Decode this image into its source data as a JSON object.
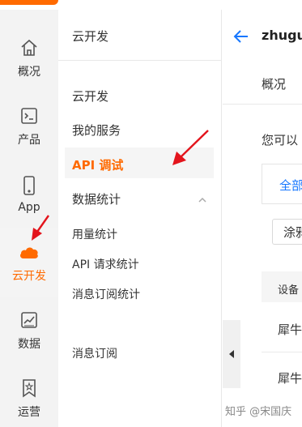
{
  "rail": {
    "items": [
      {
        "label": "概况",
        "icon": "home-icon"
      },
      {
        "label": "产品",
        "icon": "terminal-icon"
      },
      {
        "label": "App",
        "icon": "phone-icon"
      },
      {
        "label": "云开发",
        "icon": "cloud-icon"
      },
      {
        "label": "数据",
        "icon": "chart-icon"
      },
      {
        "label": "运营",
        "icon": "bookmark-star-icon"
      }
    ],
    "active_index": 3
  },
  "menu": {
    "title": "云开发",
    "items": {
      "cloud_dev": "云开发",
      "my_services": "我的服务",
      "api_debug": "API 调试",
      "data_stats": "数据统计",
      "usage_stats": "用量统计",
      "api_request_stats": "API 请求统计",
      "message_sub_stats": "消息订阅统计",
      "message_sub": "消息订阅"
    }
  },
  "main": {
    "app_name": "zhugu",
    "tab_overview": "概况",
    "intro_text": "您可以",
    "tab_all": "全部",
    "select_value": "涂鸦",
    "table_header": "设备",
    "rows": [
      "犀牛",
      "犀牛"
    ]
  },
  "watermark": "知乎 @宋国庆",
  "colors": {
    "accent": "#ff6a00",
    "link_blue": "#1677ff",
    "annotation_red": "#e3141c"
  }
}
